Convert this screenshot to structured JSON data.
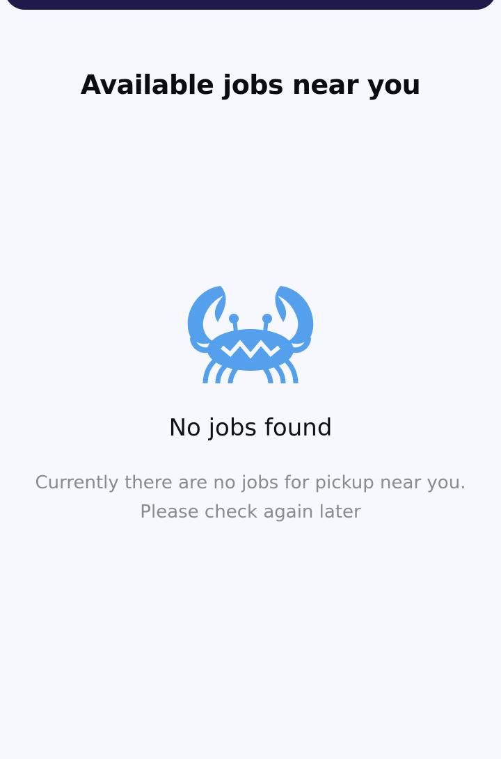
{
  "header": {
    "title": "Available jobs near you"
  },
  "empty_state": {
    "icon": "crab-icon",
    "icon_color": "#55A0EC",
    "heading": "No jobs found",
    "message_line1": "Currently there are no jobs for pickup near you.",
    "message_line2": "Please check again later"
  },
  "colors": {
    "background": "#F6F8FE",
    "top_bar": "#1E1B4B",
    "message_text": "#8A8A8F"
  }
}
